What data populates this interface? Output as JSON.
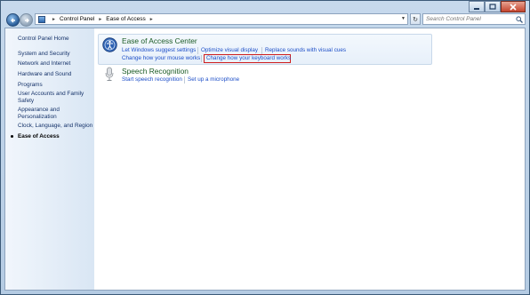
{
  "window": {
    "caption_buttons": [
      "minimize",
      "maximize",
      "close"
    ]
  },
  "navigation": {
    "breadcrumb": [
      "Control Panel",
      "Ease of Access"
    ],
    "search_placeholder": "Search Control Panel"
  },
  "sidebar": {
    "home": "Control Panel Home",
    "items": [
      "System and Security",
      "Network and Internet",
      "Hardware and Sound",
      "Programs",
      "User Accounts and Family Safety",
      "Appearance and Personalization",
      "Clock, Language, and Region",
      "Ease of Access"
    ],
    "current": "Ease of Access"
  },
  "categories": [
    {
      "title": "Ease of Access Center",
      "icon": "ease-of-access-icon",
      "tasks": [
        "Let Windows suggest settings",
        "Optimize visual display",
        "Replace sounds with visual cues",
        "Change how your mouse works",
        "Change how your keyboard works"
      ],
      "highlighted_task": "Change how your keyboard works"
    },
    {
      "title": "Speech Recognition",
      "icon": "microphone-icon",
      "tasks": [
        "Start speech recognition",
        "Set up a microphone"
      ]
    }
  ],
  "colors": {
    "link": "#1c4ec8",
    "category_title": "#1b5b25",
    "highlight_border": "#cf1c1c",
    "window_frame": "#c6d9ec"
  }
}
